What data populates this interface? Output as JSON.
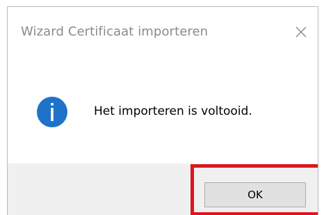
{
  "window": {
    "title": "Wizard Certificaat importeren",
    "close_icon": "close-icon"
  },
  "content": {
    "icon": "info-icon",
    "icon_color": "#1e73c9",
    "message": "Het importeren is voltooid."
  },
  "footer": {
    "ok_label": "OK",
    "highlight_color": "#e0141e"
  }
}
